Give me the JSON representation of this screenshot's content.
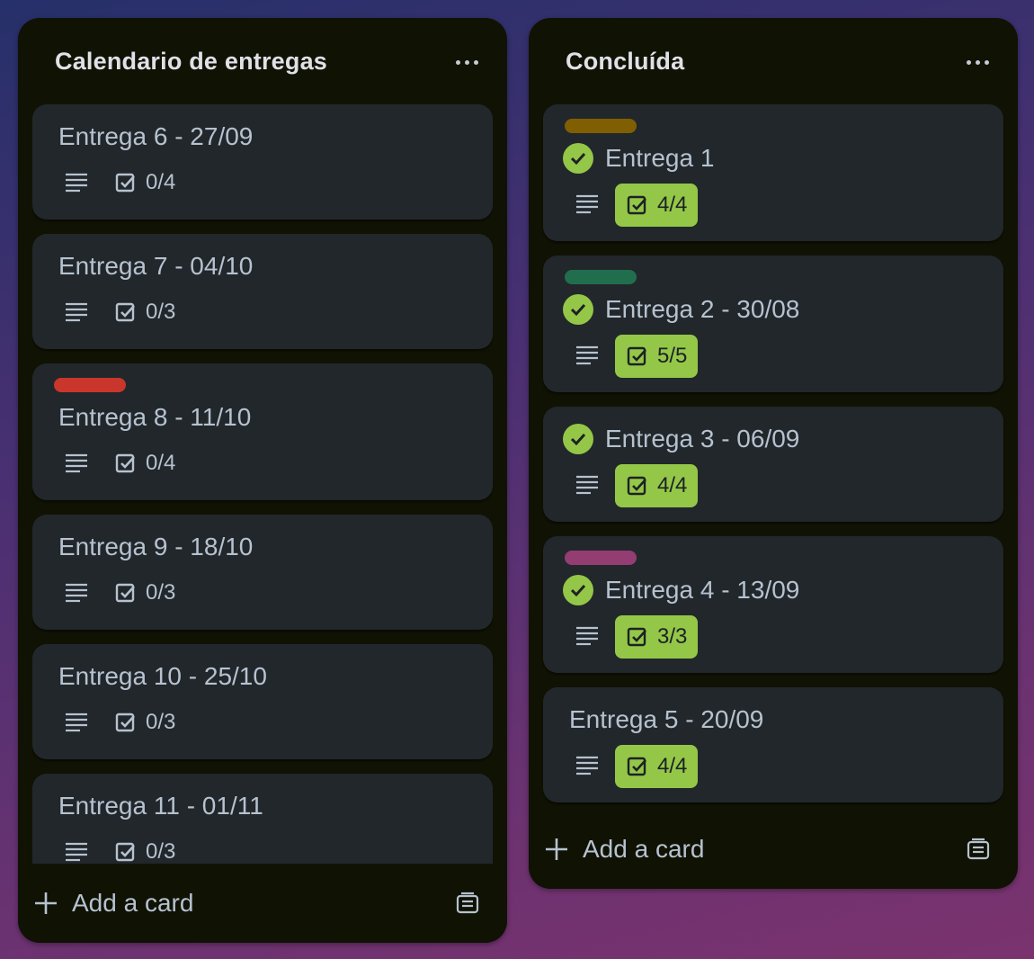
{
  "lists": [
    {
      "title": "Calendario de entregas",
      "cards": [
        {
          "title": "Entrega 6 - 27/09",
          "checklist": "0/4"
        },
        {
          "title": "Entrega 7 - 04/10",
          "checklist": "0/3"
        },
        {
          "title": "Entrega 8 - 11/10",
          "checklist": "0/4",
          "label_color": "#c9372c"
        },
        {
          "title": "Entrega 9 - 18/10",
          "checklist": "0/3"
        },
        {
          "title": "Entrega 10 - 25/10",
          "checklist": "0/3"
        },
        {
          "title": "Entrega 11 - 01/11",
          "checklist": "0/3"
        }
      ],
      "add_card_label": "Add a card"
    },
    {
      "title": "Concluída",
      "cards": [
        {
          "title": "Entrega 1",
          "checklist": "4/4",
          "label_color": "#7f5f01",
          "completed": true
        },
        {
          "title": "Entrega 2 - 30/08",
          "checklist": "5/5",
          "label_color": "#216e4e",
          "completed": true
        },
        {
          "title": "Entrega 3 - 06/09",
          "checklist": "4/4",
          "completed": true
        },
        {
          "title": "Entrega 4 - 13/09",
          "checklist": "3/3",
          "label_color": "#943d73",
          "completed": true
        },
        {
          "title": "Entrega 5 - 20/09",
          "checklist": "4/4"
        }
      ],
      "add_card_label": "Add a card"
    }
  ],
  "colors": {
    "board_bg": "#4a3072",
    "list_bg": "#101204",
    "card_bg": "#22272b",
    "complete_green": "#94c748",
    "text": "#b6c2cf"
  },
  "icons": [
    "description-icon",
    "checklist-icon",
    "complete-check-icon",
    "plus-icon",
    "card-template-icon",
    "more-icon"
  ]
}
